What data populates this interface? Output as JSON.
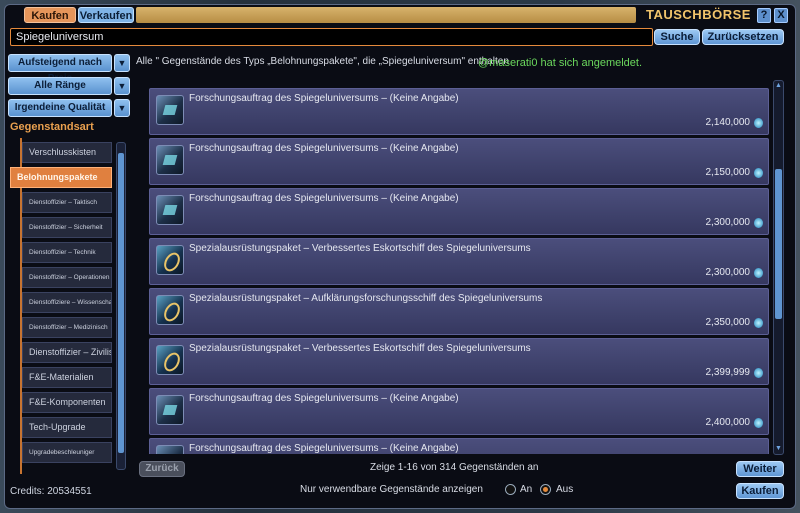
{
  "header": {
    "tab_buy": "Kaufen",
    "tab_sell": "Verkaufen",
    "title": "TAUSCHBÖRSE",
    "help": "?",
    "close": "X"
  },
  "search": {
    "value": "Spiegeluniversum",
    "search_button": "Suche",
    "reset_button": "Zurücksetzen"
  },
  "filters": {
    "sort": "Aufsteigend nach Preis",
    "rank": "Alle Ränge",
    "quality": "Irgendeine Qualität",
    "category_title": "Gegenstandsart",
    "categories": [
      {
        "label": "Verschlusskisten",
        "small": false,
        "active": false
      },
      {
        "label": "Belohnungspakete",
        "small": false,
        "active": true
      },
      {
        "label": "Dienstoffizier – Taktisch",
        "small": true,
        "active": false
      },
      {
        "label": "Dienstoffizier – Sicherheit",
        "small": true,
        "active": false
      },
      {
        "label": "Dienstoffizier – Technik",
        "small": true,
        "active": false
      },
      {
        "label": "Dienstoffizier – Operationen",
        "small": true,
        "active": false
      },
      {
        "label": "Dienstoffiziere – Wissenschaft",
        "small": true,
        "active": false
      },
      {
        "label": "Dienstoffizier – Medizinisch",
        "small": true,
        "active": false
      },
      {
        "label": "Dienstoffizier – Zivilist",
        "small": false,
        "active": false
      },
      {
        "label": "F&E-Materialien",
        "small": false,
        "active": false
      },
      {
        "label": "F&E-Komponenten",
        "small": false,
        "active": false
      },
      {
        "label": "Tech-Upgrade",
        "small": false,
        "active": false
      },
      {
        "label": "Upgradebeschleuniger",
        "small": true,
        "active": false
      }
    ]
  },
  "credits": "Credits: 20534551",
  "main": {
    "info_text": "Alle \" Gegenstände des Typs „Belohnungspakete\", die „Spiegeluniversum\" enthalten",
    "notice": "@maserati0 hat sich angemeldet.",
    "items": [
      {
        "name": "Forschungsauftrag des Spiegeluniversums – (Keine Angabe)",
        "price": "2,140,000",
        "icon": "book"
      },
      {
        "name": "Forschungsauftrag des Spiegeluniversums – (Keine Angabe)",
        "price": "2,150,000",
        "icon": "book"
      },
      {
        "name": "Forschungsauftrag des Spiegeluniversums – (Keine Angabe)",
        "price": "2,300,000",
        "icon": "book"
      },
      {
        "name": "Spezialausrüstungspaket – Verbessertes Eskortschiff des Spiegeluniversums",
        "price": "2,300,000",
        "icon": "pack"
      },
      {
        "name": "Spezialausrüstungspaket – Aufklärungsforschungsschiff des Spiegeluniversums",
        "price": "2,350,000",
        "icon": "pack"
      },
      {
        "name": "Spezialausrüstungspaket – Verbessertes Eskortschiff des Spiegeluniversums",
        "price": "2,399,999",
        "icon": "pack"
      },
      {
        "name": "Forschungsauftrag des Spiegeluniversums – (Keine Angabe)",
        "price": "2,400,000",
        "icon": "book"
      },
      {
        "name": "Forschungsauftrag des Spiegeluniversums – (Keine Angabe)",
        "price": "",
        "icon": "book"
      }
    ]
  },
  "footer": {
    "back": "Zurück",
    "showing": "Zeige 1-16 von 314 Gegenständen an",
    "next": "Weiter",
    "usable_label": "Nur verwendbare Gegenstände anzeigen",
    "radio_on": "An",
    "radio_off": "Aus",
    "usable_selected": "Aus",
    "buy": "Kaufen"
  }
}
